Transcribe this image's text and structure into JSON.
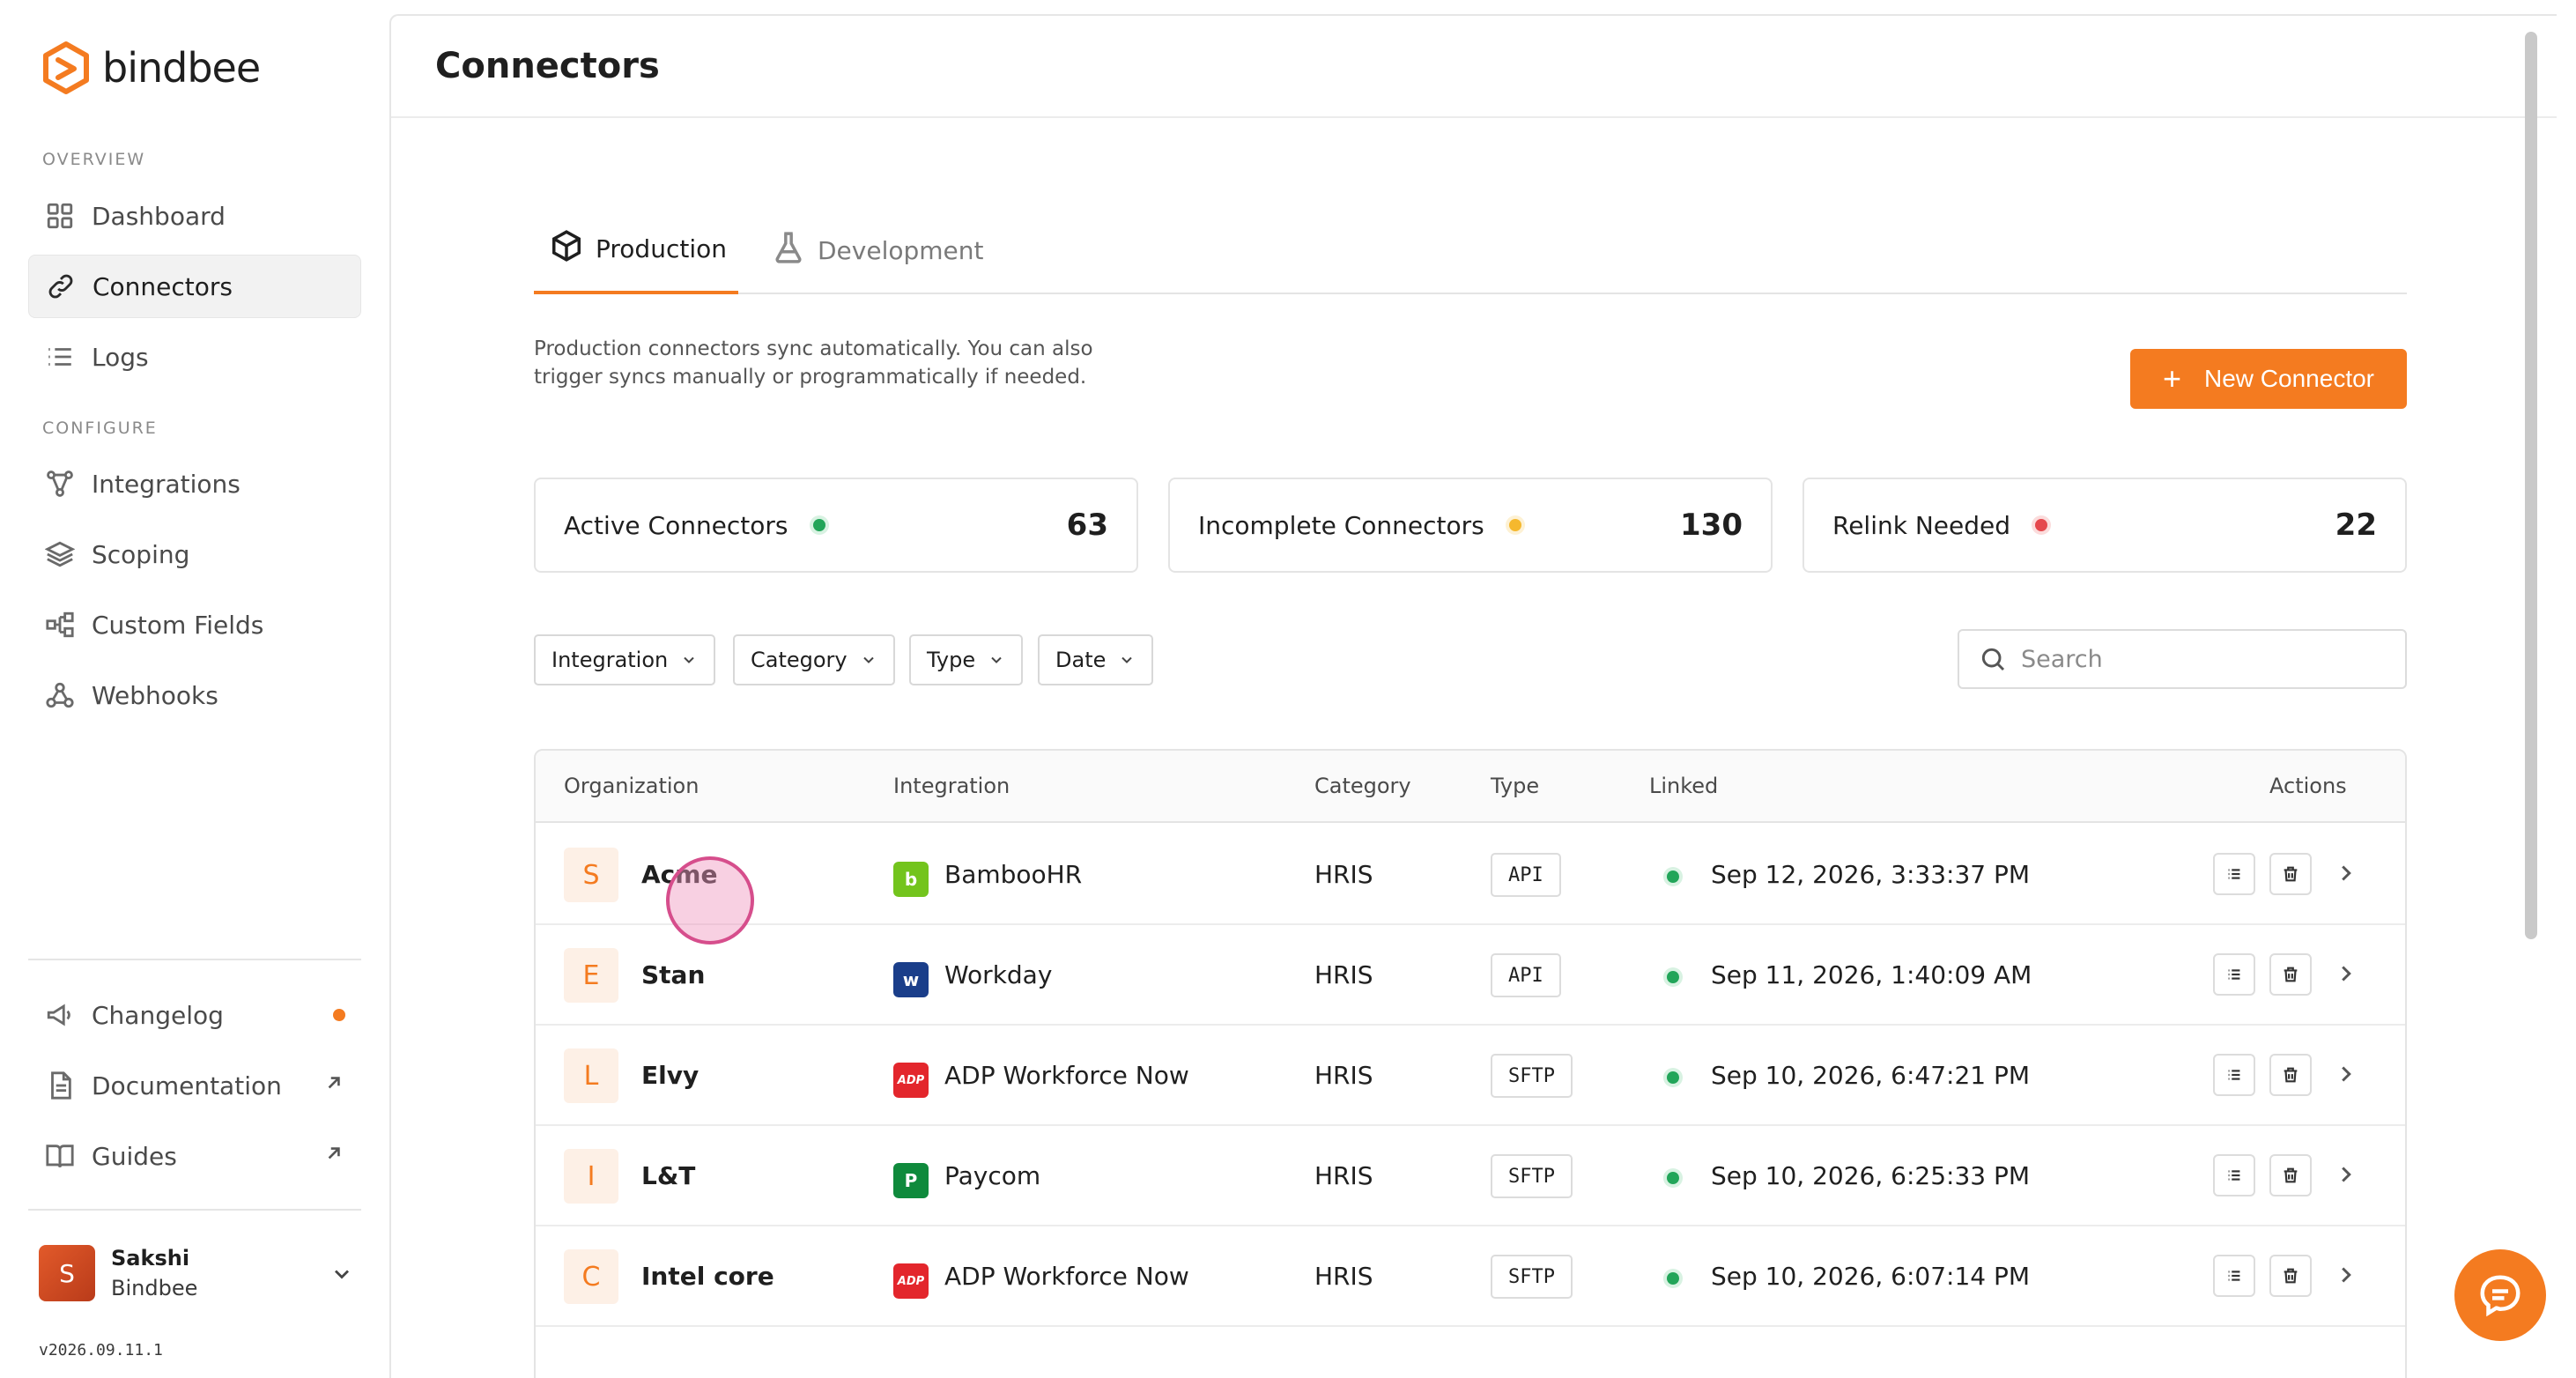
{
  "app": {
    "brand": "bindbee",
    "accent_color": "#f47b20",
    "version": "v2026.09.11.1"
  },
  "sidebar": {
    "sections": [
      {
        "label": "OVERVIEW"
      },
      {
        "label": "CONFIGURE"
      }
    ],
    "items": [
      {
        "label": "Dashboard",
        "icon": "dashboard-grid-icon"
      },
      {
        "label": "Connectors",
        "icon": "link-icon",
        "active": true
      },
      {
        "label": "Logs",
        "icon": "list-icon"
      },
      {
        "label": "Integrations",
        "icon": "nodes-icon"
      },
      {
        "label": "Scoping",
        "icon": "layers-icon"
      },
      {
        "label": "Custom Fields",
        "icon": "hierarchy-icon"
      },
      {
        "label": "Webhooks",
        "icon": "webhook-icon"
      }
    ],
    "bottom_items": [
      {
        "label": "Changelog",
        "icon": "megaphone-icon",
        "badge_color": "#f47b20"
      },
      {
        "label": "Documentation",
        "icon": "document-icon",
        "trail": "external-arrow-icon"
      },
      {
        "label": "Guides",
        "icon": "book-icon",
        "trail": "external-arrow-icon"
      }
    ],
    "user": {
      "initial": "S",
      "name": "Sakshi",
      "org": "Bindbee"
    }
  },
  "main": {
    "title": "Connectors",
    "tabs": [
      {
        "label": "Production",
        "icon": "cube-icon",
        "active": true
      },
      {
        "label": "Development",
        "icon": "flask-icon"
      }
    ],
    "description": "Production connectors sync automatically. You can also trigger syncs manually or programmatically if needed.",
    "new_button_label": "New Connector",
    "stats": [
      {
        "label": "Active Connectors",
        "value": "63",
        "dot_color": "#22a559"
      },
      {
        "label": "Incomplete Connectors",
        "value": "130",
        "dot_color": "#f5b82e"
      },
      {
        "label": "Relink Needed",
        "value": "22",
        "dot_color": "#e5484d"
      }
    ],
    "filters": [
      {
        "label": "Integration"
      },
      {
        "label": "Category"
      },
      {
        "label": "Type"
      },
      {
        "label": "Date"
      }
    ],
    "search": {
      "placeholder": "Search",
      "value": ""
    },
    "table": {
      "columns": [
        "Organization",
        "Integration",
        "Category",
        "Type",
        "Linked",
        "Actions"
      ],
      "rows": [
        {
          "initial": "S",
          "org": "Acme",
          "integration": "BambooHR",
          "logo_color": "#73c41d",
          "logo_glyph": "b",
          "category": "HRIS",
          "type": "API",
          "linked": "Sep 12, 2026, 3:33:37 PM"
        },
        {
          "initial": "E",
          "org": "Stan",
          "integration": "Workday",
          "logo_color": "#1a3e8a",
          "logo_glyph": "w",
          "category": "HRIS",
          "type": "API",
          "linked": "Sep 11, 2026, 1:40:09 AM"
        },
        {
          "initial": "L",
          "org": "Elvy",
          "integration": "ADP Workforce Now",
          "logo_color": "#e3262c",
          "logo_glyph": "ADP",
          "category": "HRIS",
          "type": "SFTP",
          "linked": "Sep 10, 2026, 6:47:21 PM"
        },
        {
          "initial": "I",
          "org": "L&T",
          "integration": "Paycom",
          "logo_color": "#0f8a3c",
          "logo_glyph": "P",
          "category": "HRIS",
          "type": "SFTP",
          "linked": "Sep 10, 2026, 6:25:33 PM"
        },
        {
          "initial": "C",
          "org": "Intel core",
          "integration": "ADP Workforce Now",
          "logo_color": "#e3262c",
          "logo_glyph": "ADP",
          "category": "HRIS",
          "type": "SFTP",
          "linked": "Sep 10, 2026, 6:07:14 PM"
        }
      ]
    }
  }
}
